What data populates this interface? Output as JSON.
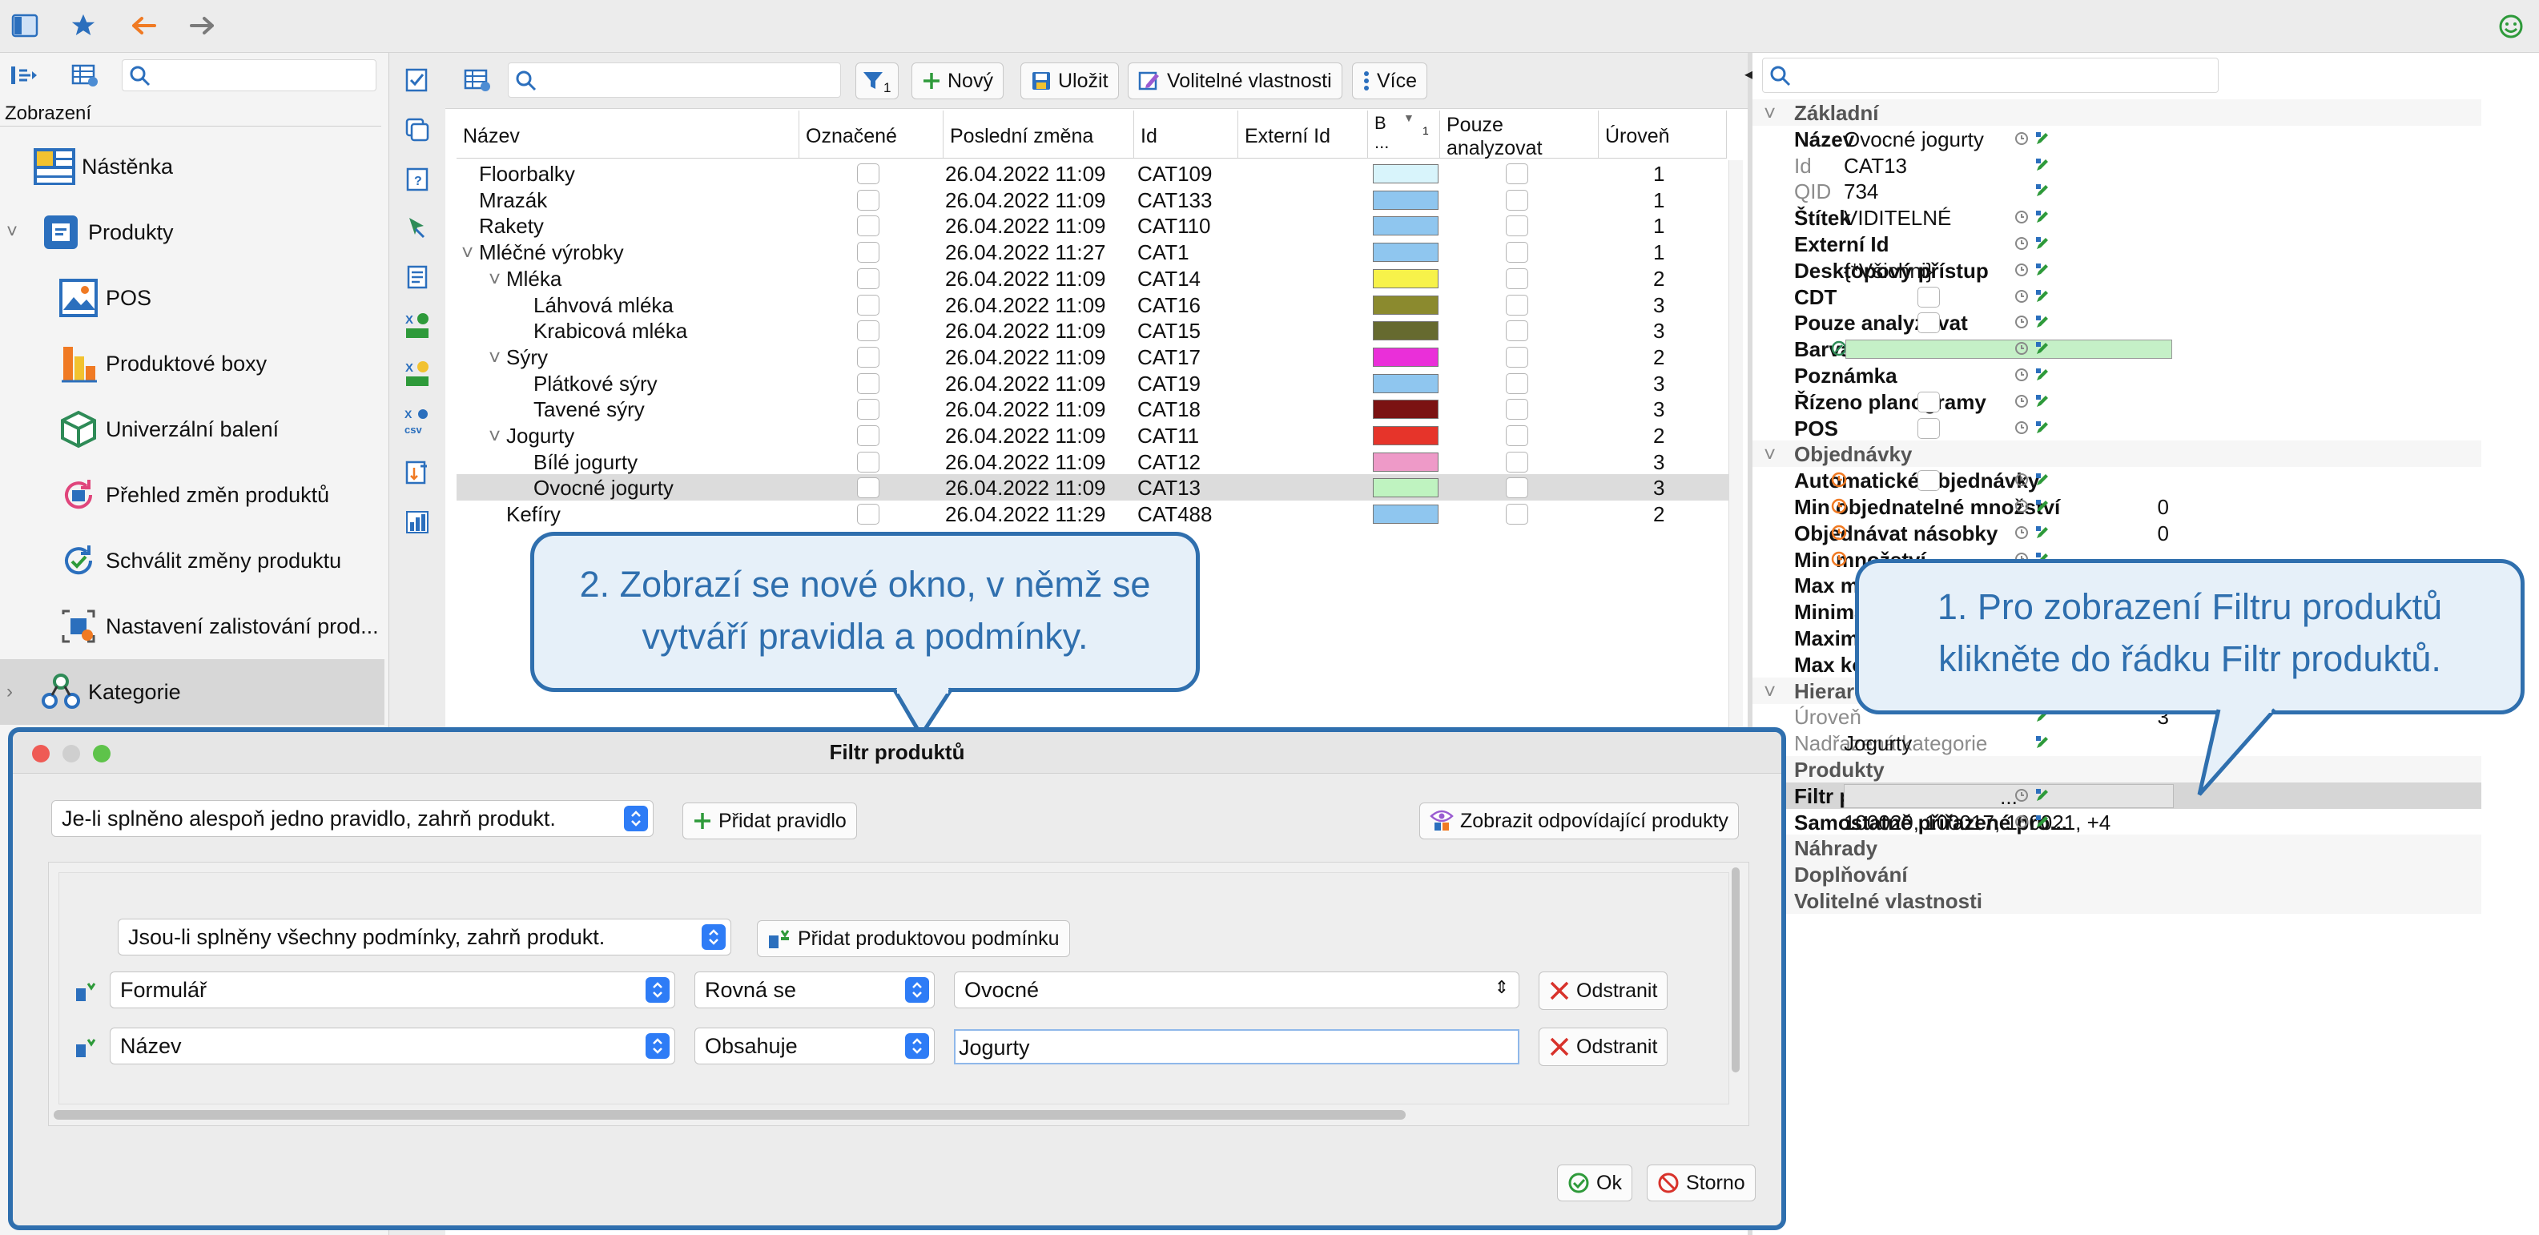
{
  "left_panel": {
    "header": "Zobrazení",
    "items": [
      {
        "label": "Nástěnka",
        "icon": "dashboard-icon"
      },
      {
        "label": "Produkty",
        "icon": "products-icon"
      },
      {
        "label": "POS",
        "icon": "pos-icon"
      },
      {
        "label": "Produktové boxy",
        "icon": "product-boxes-icon"
      },
      {
        "label": "Univerzální balení",
        "icon": "package-icon"
      },
      {
        "label": "Přehled změn produktů",
        "icon": "changes-overview-icon"
      },
      {
        "label": "Schválit změny produktu",
        "icon": "approve-changes-icon"
      },
      {
        "label": "Nastavení zalistování prod...",
        "icon": "listing-settings-icon"
      },
      {
        "label": "Kategorie",
        "icon": "categories-icon"
      }
    ]
  },
  "toolbar": {
    "filter_badge": "1",
    "new_label": "Nový",
    "save_label": "Uložit",
    "custom_props_label": "Volitelné vlastnosti",
    "more_label": "Více"
  },
  "table": {
    "columns": {
      "name": "Název",
      "marked": "Označené",
      "last_change": "Poslední změna",
      "id": "Id",
      "external_id": "Externí Id",
      "color": "B ...",
      "color_sort": "1",
      "analyze_only": "Pouze analyzovat",
      "level": "Úroveň"
    },
    "rows": [
      {
        "name": "Floorbalky",
        "indent": 0,
        "expander": "",
        "date": "26.04.2022 11:09",
        "id": "CAT109",
        "color": "#d8f4fb",
        "level": "1"
      },
      {
        "name": "Mrazák",
        "indent": 0,
        "expander": "",
        "date": "26.04.2022 11:09",
        "id": "CAT133",
        "color": "#8fc6ef",
        "level": "1"
      },
      {
        "name": "Rakety",
        "indent": 0,
        "expander": "",
        "date": "26.04.2022 11:09",
        "id": "CAT110",
        "color": "#8fc6ef",
        "level": "1"
      },
      {
        "name": "Mléčné výrobky",
        "indent": 0,
        "expander": "˅",
        "date": "26.04.2022 11:27",
        "id": "CAT1",
        "color": "#8fc6ef",
        "level": "1"
      },
      {
        "name": "Mléka",
        "indent": 1,
        "expander": "˅",
        "date": "26.04.2022 11:09",
        "id": "CAT14",
        "color": "#f7f24a",
        "level": "2"
      },
      {
        "name": "Láhvová mléka",
        "indent": 2,
        "expander": "",
        "date": "26.04.2022 11:09",
        "id": "CAT16",
        "color": "#8b8a2e",
        "level": "3"
      },
      {
        "name": "Krabicová mléka",
        "indent": 2,
        "expander": "",
        "date": "26.04.2022 11:09",
        "id": "CAT15",
        "color": "#666a2f",
        "level": "3"
      },
      {
        "name": "Sýry",
        "indent": 1,
        "expander": "˅",
        "date": "26.04.2022 11:09",
        "id": "CAT17",
        "color": "#ea2fd9",
        "level": "2"
      },
      {
        "name": "Plátkové sýry",
        "indent": 2,
        "expander": "",
        "date": "26.04.2022 11:09",
        "id": "CAT19",
        "color": "#8fc6ef",
        "level": "3"
      },
      {
        "name": "Tavené sýry",
        "indent": 2,
        "expander": "",
        "date": "26.04.2022 11:09",
        "id": "CAT18",
        "color": "#7b1212",
        "level": "3"
      },
      {
        "name": "Jogurty",
        "indent": 1,
        "expander": "˅",
        "date": "26.04.2022 11:09",
        "id": "CAT11",
        "color": "#e6342a",
        "level": "2"
      },
      {
        "name": "Bílé jogurty",
        "indent": 2,
        "expander": "",
        "date": "26.04.2022 11:09",
        "id": "CAT12",
        "color": "#ee9ac8",
        "level": "3"
      },
      {
        "name": "Ovocné jogurty",
        "indent": 2,
        "expander": "",
        "date": "26.04.2022 11:09",
        "id": "CAT13",
        "color": "#bff3c0",
        "level": "3",
        "selected": true
      },
      {
        "name": "Kefíry",
        "indent": 1,
        "expander": "",
        "date": "26.04.2022 11:29",
        "id": "CAT488",
        "color": "#8fc6ef",
        "level": "2"
      }
    ]
  },
  "properties": {
    "rows": [
      {
        "type": "section",
        "label": "Základní",
        "expander": "˅"
      },
      {
        "label": "Název",
        "value": "Ovocné jogurty"
      },
      {
        "label": "Id",
        "value": "CAT13",
        "dim": true
      },
      {
        "label": "QID",
        "value": "734",
        "dim": true
      },
      {
        "label": "Štítek",
        "value": "VIDITELNÉ"
      },
      {
        "label": "Externí Id",
        "value": ""
      },
      {
        "label": "Desktopový přístup",
        "value": "{*Všichni}"
      },
      {
        "label": "CDT",
        "value": "",
        "checkbox": true
      },
      {
        "label": "Pouze analyzovat",
        "value": "",
        "checkbox": true
      },
      {
        "label": "Barva",
        "value": "",
        "color": "#c5f0c7"
      },
      {
        "label": "Poznámka",
        "value": ""
      },
      {
        "label": "Řízeno planogramy",
        "value": "",
        "checkbox": true
      },
      {
        "label": "POS",
        "value": "",
        "checkbox": true
      },
      {
        "type": "section",
        "label": "Objednávky",
        "expander": "˅"
      },
      {
        "label": "Automatické objednávky",
        "value": "",
        "checkbox": true,
        "orange": true
      },
      {
        "label": "Min objednatelné množství",
        "value": "0",
        "orange": true,
        "num": true
      },
      {
        "label": "Objednávat násobky",
        "value": "0",
        "orange": true,
        "num": true
      },
      {
        "label": "Min množství",
        "value": "",
        "orange": true
      },
      {
        "label": "Max množství",
        "value": ""
      },
      {
        "label": "Minimální",
        "value": ""
      },
      {
        "label": "Maximální",
        "value": ""
      },
      {
        "label": "Max koeficient",
        "value": ""
      },
      {
        "type": "section",
        "label": "Hierarchie",
        "expander": "˅"
      },
      {
        "label": "Úroveň",
        "value": "3",
        "dim": true,
        "num": true
      },
      {
        "label": "Nadřazená kategorie",
        "value": "Jogurty",
        "dim": true
      },
      {
        "type": "section",
        "label": "Produkty",
        "expander": ""
      },
      {
        "label": "Filtr produktů",
        "value": "...",
        "highlight": true
      },
      {
        "label": "Samostatně přiřazené pro...",
        "value": "100020, 100017, 100021, +4"
      },
      {
        "type": "section",
        "label": "Náhrady",
        "expander": ""
      },
      {
        "type": "section",
        "label": "Doplňování",
        "expander": ""
      },
      {
        "type": "section",
        "label": "Volitelné vlastnosti",
        "expander": ""
      }
    ]
  },
  "dialog": {
    "title": "Filtr produktů",
    "rule_mode": "Je-li splněno alespoň jedno pravidlo, zahrň produkt.",
    "add_rule_label": "Přidat pravidlo",
    "show_matching_label": "Zobrazit odpovídající produkty",
    "condition_mode": "Jsou-li splněny všechny podmínky, zahrň produkt.",
    "add_condition_label": "Přidat produktovou podmínku",
    "conditions": [
      {
        "field": "Formulář",
        "operator": "Rovná se",
        "value": "Ovocné",
        "value_type": "select",
        "remove": "Odstranit"
      },
      {
        "field": "Název",
        "operator": "Obsahuje",
        "value": "Jogurty",
        "value_type": "text",
        "remove": "Odstranit"
      }
    ],
    "ok_label": "Ok",
    "cancel_label": "Storno"
  },
  "callouts": {
    "one": "1. Pro zobrazení Filtru produktů klikněte do řádku Filtr produktů.",
    "two": "2. Zobrazí se nové okno, v němž se vytváří pravidla a podmínky."
  },
  "colors": {
    "accent": "#2f6fae",
    "callout_bg": "#e6f0f9",
    "selected_row": "#dcdcdc",
    "toggle_blue": "#2e7cf6"
  }
}
